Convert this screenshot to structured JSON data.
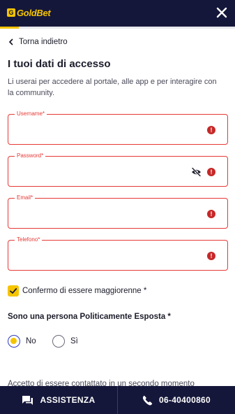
{
  "header": {
    "logo_mark": "G",
    "logo_text": "GoldBet",
    "close_icon": "close-icon"
  },
  "progress": {
    "fraction": 0.08,
    "color": "#f5c400"
  },
  "nav": {
    "back_label": "Torna indietro"
  },
  "section": {
    "title": "I tuoi dati di accesso",
    "subtitle": "Li userai per accedere al portale, alle app e per interagire con la community."
  },
  "fields": {
    "username": {
      "label": "Username*",
      "value": ""
    },
    "password": {
      "label": "Password*",
      "value": ""
    },
    "email": {
      "label": "Email*",
      "value": ""
    },
    "phone": {
      "label": "Telefono*",
      "value": ""
    },
    "error_glyph": "!"
  },
  "age_confirm": {
    "label": "Confermo di essere maggiorenne *",
    "checked": true
  },
  "pep": {
    "question": "Sono una persona Politicamente Esposta *",
    "options": [
      {
        "label": "No",
        "selected": true
      },
      {
        "label": "Sì",
        "selected": false
      }
    ]
  },
  "consent": {
    "text": "Accetto di essere contattato in un secondo momento"
  },
  "footer": {
    "assistance_label": "ASSISTENZA",
    "phone_label": "06-40400860"
  },
  "colors": {
    "navy": "#15173a",
    "gold": "#f5c400",
    "error": "#e53935"
  }
}
